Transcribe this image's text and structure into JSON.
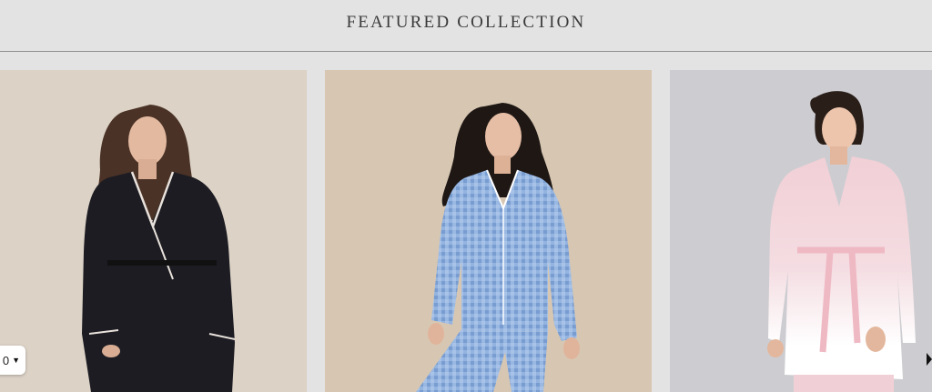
{
  "header": {
    "title": "FEATURED COLLECTION"
  },
  "products": [
    {
      "name": "black robe product",
      "background": "#dcd2c6",
      "garment_color": "#1c1c22"
    },
    {
      "name": "blue gingham pajama product",
      "background": "#d7c7b2",
      "garment_color": "#9ab7e0"
    },
    {
      "name": "pink ombre robe product",
      "background": "#cdcdd1",
      "garment_color": "#f1d3da"
    }
  ],
  "currency_selector": {
    "value": "0",
    "icon": "chevron-down-icon"
  },
  "carousel": {
    "next_icon": "chevron-right-icon"
  }
}
